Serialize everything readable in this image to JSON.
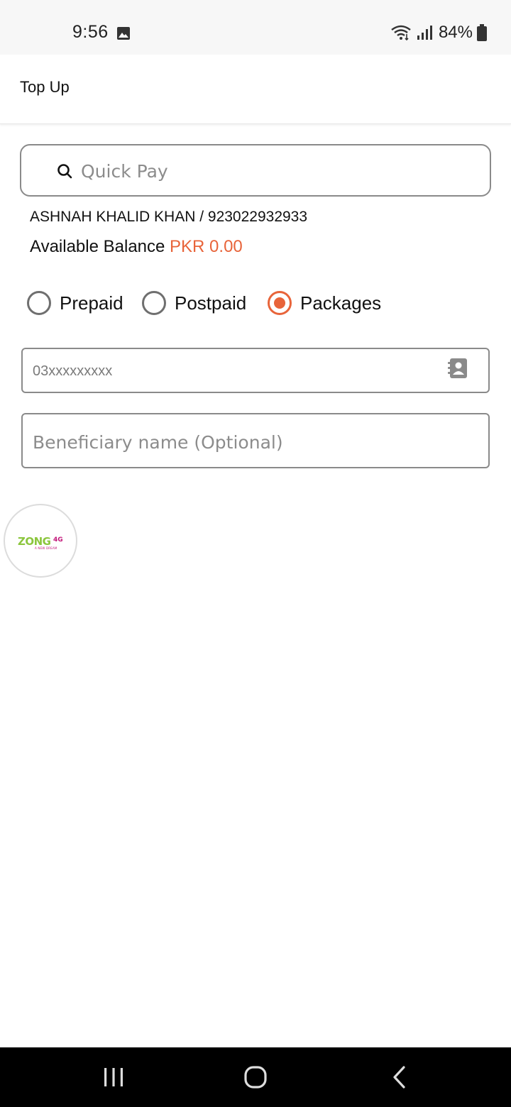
{
  "status_bar": {
    "time": "9:56",
    "battery": "84%",
    "icons": [
      "gallery-icon",
      "wifi-icon",
      "signal-icon",
      "battery-icon"
    ]
  },
  "app_bar": {
    "title": "Top Up"
  },
  "quick_pay": {
    "placeholder": "Quick Pay",
    "icon": "search-icon"
  },
  "account": {
    "holder": "ASHNAH KHALID KHAN / 923022932933",
    "balance_label": "Available Balance",
    "balance_amount": "PKR 0.00"
  },
  "payment_type": {
    "options": [
      {
        "label": "Prepaid",
        "selected": false
      },
      {
        "label": "Postpaid",
        "selected": false
      },
      {
        "label": "Packages",
        "selected": true
      }
    ]
  },
  "phone_field": {
    "placeholder": "03xxxxxxxxx",
    "icon": "contacts-icon"
  },
  "beneficiary_field": {
    "placeholder": "Beneficiary name (Optional)"
  },
  "operator": {
    "brand": "ZONG",
    "brand_sup": "4G",
    "tagline": "A NEW DREAM"
  },
  "colors": {
    "accent": "#e8643a",
    "border": "#8a8a8a",
    "zong_green": "#8cc63e",
    "zong_pink": "#c2177a"
  }
}
